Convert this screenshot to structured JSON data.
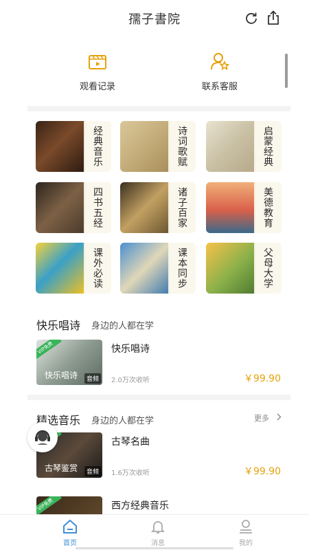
{
  "header": {
    "title": "孺子書院",
    "refresh_icon": "refresh-icon",
    "share_icon": "share-icon"
  },
  "quick_actions": [
    {
      "label": "观看记录",
      "icon": "video-playlist-icon",
      "color": "#e6a10a"
    },
    {
      "label": "联系客服",
      "icon": "customer-service-icon",
      "color": "#e6a10a"
    }
  ],
  "categories": [
    {
      "label": "经典音乐"
    },
    {
      "label": "诗词歌赋"
    },
    {
      "label": "启蒙经典"
    },
    {
      "label": "四书五经"
    },
    {
      "label": "诸子百家"
    },
    {
      "label": "美德教育"
    },
    {
      "label": "课外必读"
    },
    {
      "label": "课本同步"
    },
    {
      "label": "父母大学"
    }
  ],
  "sections": [
    {
      "title": "快乐唱诗",
      "subtitle": "身边的人都在学",
      "courses": [
        {
          "thumb_title": "快乐唱诗",
          "badge": "VIP免费",
          "type_tag": "音频",
          "title": "快乐唱诗",
          "count": "2.0万次收听",
          "price": "￥99.90"
        }
      ]
    },
    {
      "title": "精选音乐",
      "subtitle": "身边的人都在学",
      "more": "更多",
      "courses": [
        {
          "thumb_title": "古琴鉴赏",
          "badge": "VIP免费",
          "type_tag": "音频",
          "title": "古琴名曲",
          "count": "1.6万次收听",
          "price": "￥99.90"
        },
        {
          "thumb_title": "",
          "badge": "VIP免费",
          "type_tag": "",
          "title": "西方经典音乐",
          "count": "",
          "price": ""
        }
      ]
    }
  ],
  "tabbar": [
    {
      "label": "首页",
      "icon": "home-icon",
      "active": true
    },
    {
      "label": "消息",
      "icon": "bell-icon",
      "active": false
    },
    {
      "label": "我的",
      "icon": "user-icon",
      "active": false
    }
  ],
  "colors": {
    "accent": "#e6a10a",
    "tab_active": "#3f8fd8",
    "vip_green": "#3bb35a"
  }
}
